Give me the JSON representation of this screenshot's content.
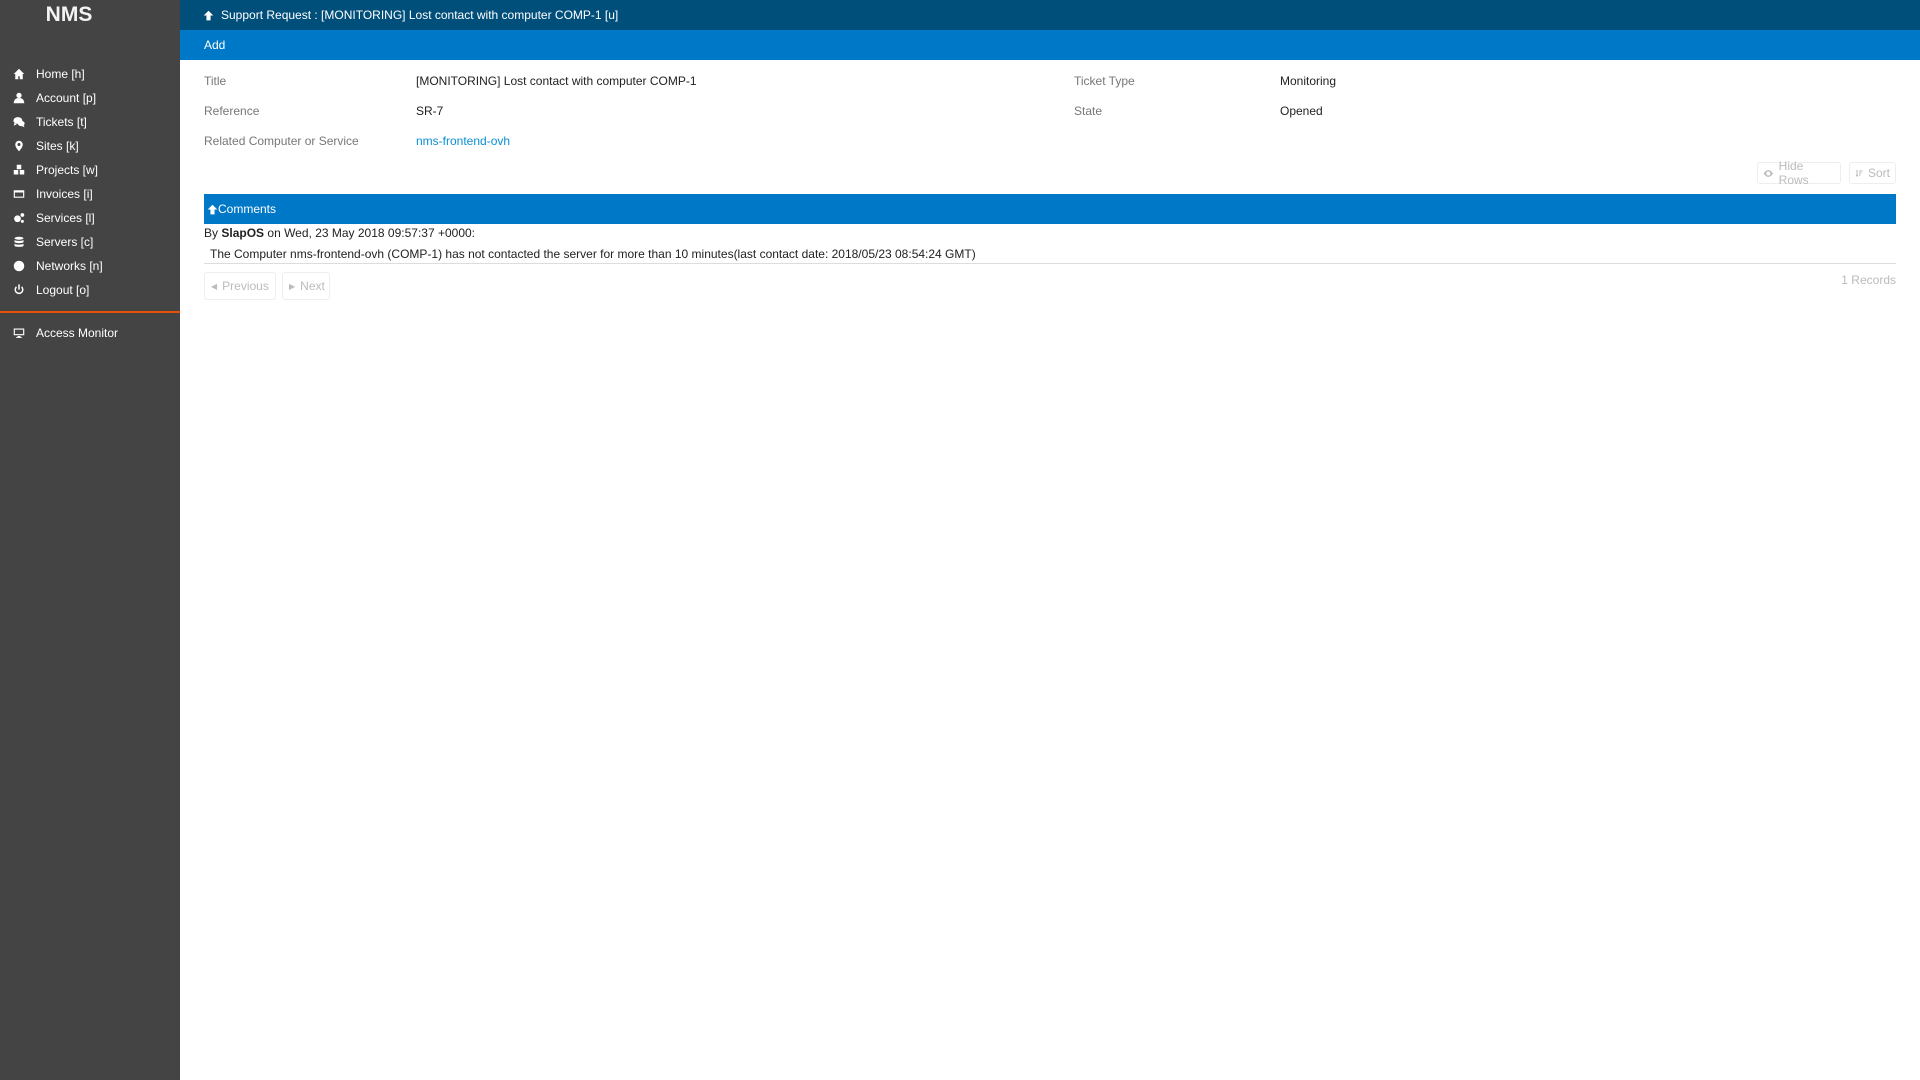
{
  "sidebar": {
    "brand": "NMS",
    "items": [
      {
        "label": "Home [h]",
        "icon": "home-icon"
      },
      {
        "label": "Account [p]",
        "icon": "user-icon"
      },
      {
        "label": "Tickets [t]",
        "icon": "comments-icon"
      },
      {
        "label": "Sites [k]",
        "icon": "map-marker-icon"
      },
      {
        "label": "Projects [w]",
        "icon": "cubes-icon"
      },
      {
        "label": "Invoices [i]",
        "icon": "credit-card-icon"
      },
      {
        "label": "Services [l]",
        "icon": "cogs-icon"
      },
      {
        "label": "Servers [c]",
        "icon": "database-icon"
      },
      {
        "label": "Networks [n]",
        "icon": "globe-icon"
      },
      {
        "label": "Logout [o]",
        "icon": "power-icon"
      }
    ],
    "extra_items": [
      {
        "label": "Access Monitor",
        "icon": "desktop-icon"
      }
    ]
  },
  "header": {
    "title": "Support Request : [MONITORING] Lost contact with computer COMP-1 [u]",
    "up_icon": "arrow-up-icon"
  },
  "actions": {
    "add_label": "Add"
  },
  "fields": {
    "title_label": "Title",
    "title_value": "[MONITORING] Lost contact with computer COMP-1",
    "reference_label": "Reference",
    "reference_value": "SR-7",
    "related_label": "Related Computer or Service",
    "related_value": "nms-frontend-ovh",
    "ticket_type_label": "Ticket Type",
    "ticket_type_value": "Monitoring",
    "state_label": "State",
    "state_value": "Opened"
  },
  "listbox": {
    "hide_rows_label": "Hide Rows",
    "sort_label": "Sort",
    "title": "Comments",
    "comments": [
      {
        "by_prefix": "By",
        "author": "SlapOS",
        "date_suffix": "on Wed, 23 May 2018 09:57:37 +0000:",
        "text": "The Computer nms-frontend-ovh (COMP-1) has not contacted the server for more than 10 minutes(last contact date: 2018/05/23 08:54:24 GMT)"
      }
    ],
    "previous_label": "Previous",
    "next_label": "Next",
    "records_label": "1 Records"
  },
  "colors": {
    "sidebar_bg": "#444444",
    "header_bg": "#004e7a",
    "accent": "#0078c8",
    "separator": "#e8500a",
    "link": "#0a8ed6"
  }
}
